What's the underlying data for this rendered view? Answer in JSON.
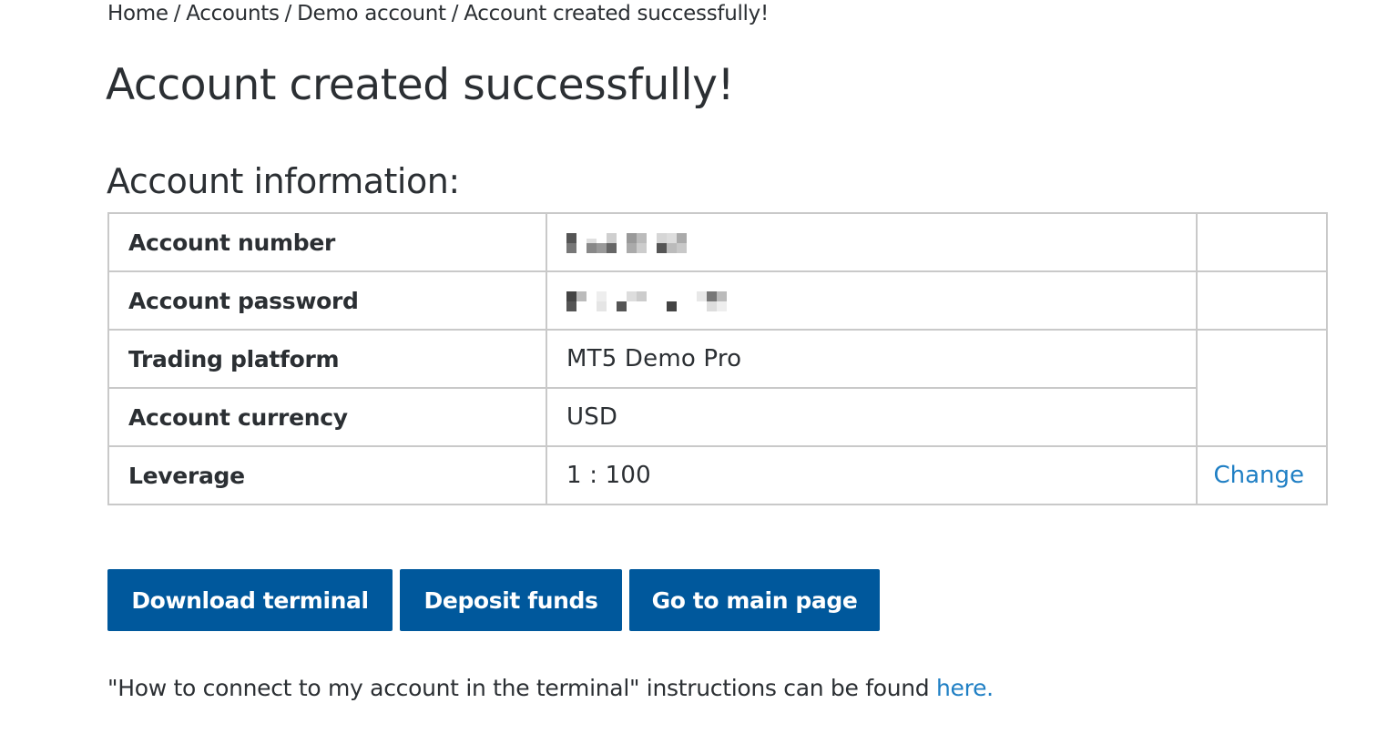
{
  "breadcrumb": {
    "items": [
      "Home",
      "Accounts",
      "Demo account",
      "Account created successfully!"
    ],
    "separator": "/"
  },
  "title": "Account created successfully!",
  "section_title": "Account information:",
  "account_table": {
    "rows": [
      {
        "label": "Account number",
        "value": "",
        "value_redacted": true
      },
      {
        "label": "Account password",
        "value": "",
        "value_redacted": true
      },
      {
        "label": "Trading platform",
        "value": "MT5 Demo Pro"
      },
      {
        "label": "Account currency",
        "value": "USD"
      },
      {
        "label": "Leverage",
        "value": "1 : 100",
        "action": "Change"
      }
    ]
  },
  "buttons": {
    "download": "Download terminal",
    "deposit": "Deposit funds",
    "main_page": "Go to main page"
  },
  "instructions": {
    "text": "\"How to connect to my account in the terminal\" instructions can be found ",
    "link": "here",
    "suffix": "."
  },
  "colors": {
    "primary_button": "#00589c",
    "link": "#1f7fc4",
    "table_border": "#c9c9c9",
    "text": "#2b2f33"
  }
}
